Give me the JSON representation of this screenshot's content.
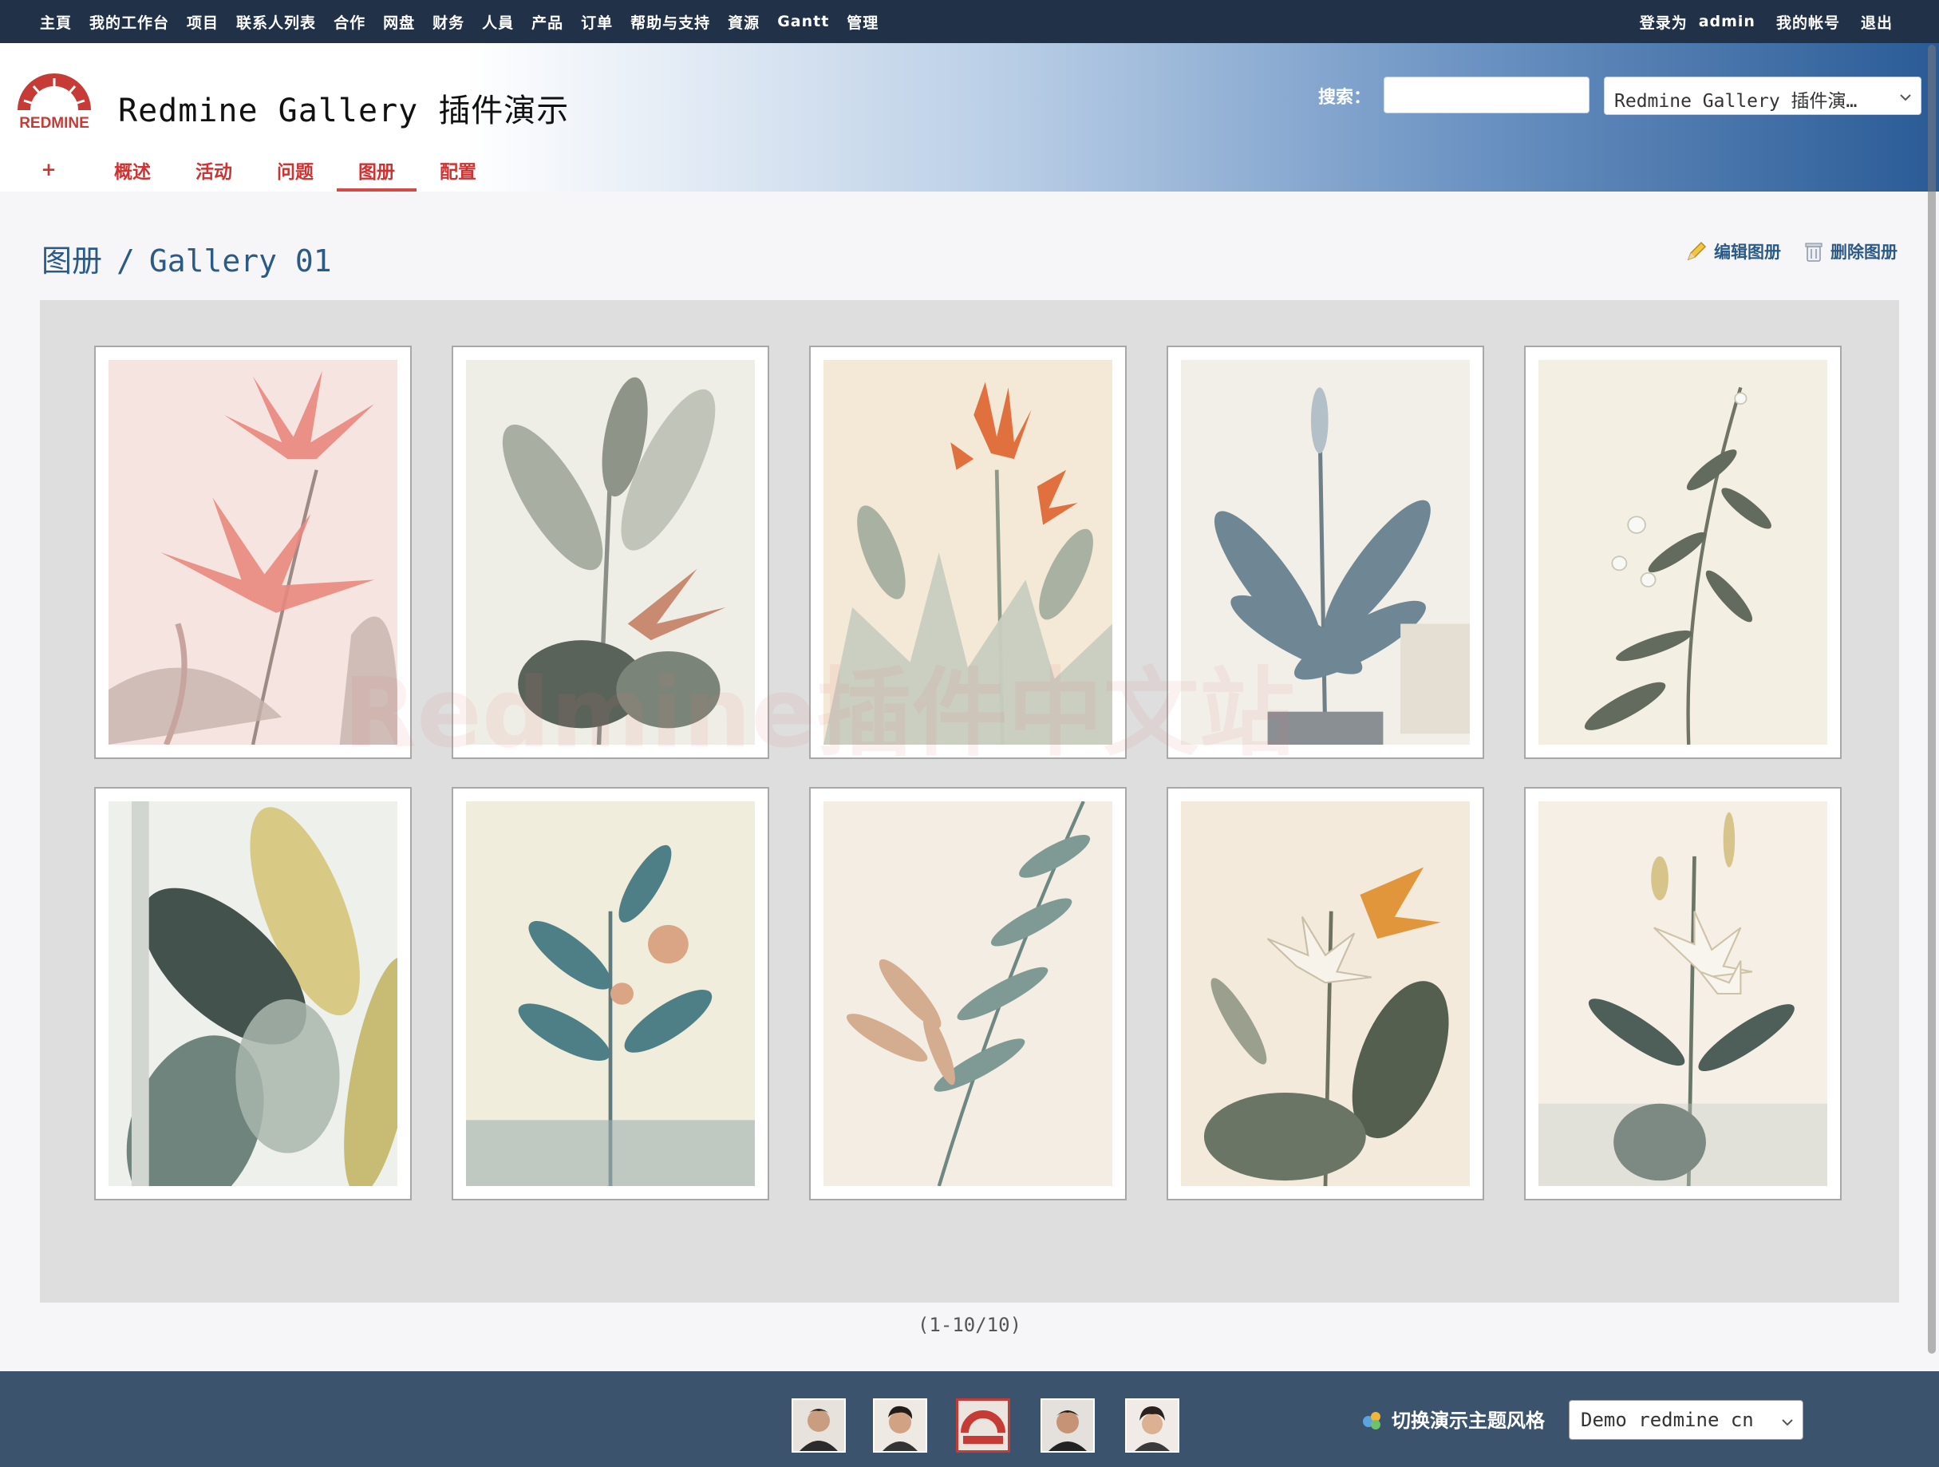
{
  "top_menu": {
    "items": [
      "主頁",
      "我的工作台",
      "项目",
      "联系人列表",
      "合作",
      "网盘",
      "财务",
      "人員",
      "产品",
      "订单",
      "帮助与支持",
      "資源",
      "Gantt",
      "管理"
    ],
    "logged_in_label": "登录为",
    "user": "admin",
    "my_account": "我的帐号",
    "logout": "退出"
  },
  "header": {
    "logo_text": "REDMINE",
    "project_title": "Redmine Gallery 插件演示",
    "search_label": "搜索：",
    "search_placeholder": "",
    "project_select": "Redmine Gallery 插件演…"
  },
  "main_menu": {
    "tabs": [
      {
        "label": "+"
      },
      {
        "label": "概述"
      },
      {
        "label": "活动"
      },
      {
        "label": "问题"
      },
      {
        "label": "图册"
      },
      {
        "label": "配置"
      }
    ],
    "selected": "图册"
  },
  "content": {
    "breadcrumb_parent": "图册",
    "breadcrumb_sep": "/",
    "breadcrumb_current": "Gallery 01",
    "edit_label": "编辑图册",
    "delete_label": "删除图册",
    "pagination": "(1-10/10)"
  },
  "gallery": {
    "photos": [
      "pink-palm",
      "banana-leaves",
      "orange-lily",
      "blue-leaf-plant",
      "white-blossom-stem",
      "watercolor-leaves",
      "teal-flower",
      "fern-fronds",
      "lily-orange-bird",
      "white-lily"
    ]
  },
  "watermark": "Redmine插件中文站",
  "footer": {
    "theme_label": "切换演示主题风格",
    "theme_select": "Demo redmine cn"
  },
  "colors": {
    "top_bar": "#213248",
    "tab_text": "#cc3333",
    "link": "#2c5a86",
    "footer": "#3c536e"
  }
}
